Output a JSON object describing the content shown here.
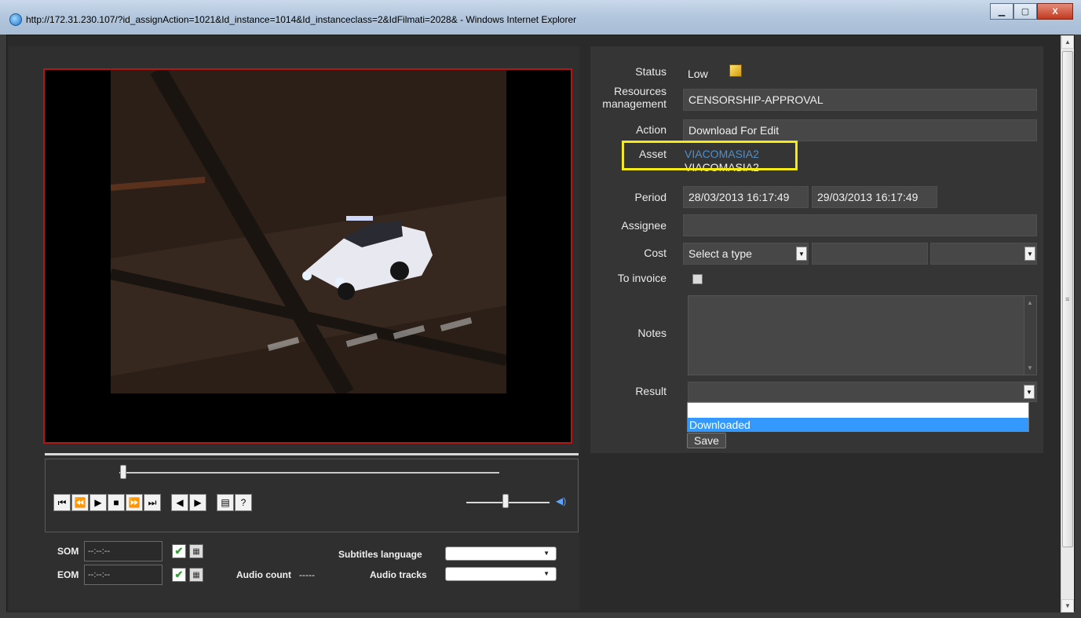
{
  "window": {
    "title": "http://172.31.230.107/?id_assignAction=1021&Id_instance=1014&Id_instanceclass=2&IdFilmati=2028& - Windows Internet Explorer",
    "min_icon": "minimize-icon",
    "max_icon": "maximize-icon",
    "close_label": "X"
  },
  "player": {
    "buttons": [
      "⏮",
      "⏪",
      "▶",
      "■",
      "⏩",
      "⏭"
    ],
    "frame_buttons": [
      "◀",
      "▶"
    ],
    "extra_buttons": [
      "▤",
      "?"
    ],
    "seek_fraction": 0.02,
    "volume_fraction": 0.5
  },
  "timecode": {
    "som_label": "SOM",
    "som_value": "--:--:--",
    "eom_label": "EOM",
    "eom_value": "--:--:--",
    "audio_count_label": "Audio count",
    "audio_count_value": "-----",
    "subtitles_label": "Subtitles language",
    "audio_tracks_label": "Audio tracks"
  },
  "form": {
    "status_label": "Status",
    "status_value": "Low",
    "resources_label_1": "Resources",
    "resources_label_2": "management",
    "resources_value": "CENSORSHIP-APPROVAL",
    "action_label": "Action",
    "action_value": "Download For Edit",
    "asset_label": "Asset",
    "asset_link": "VIACOMASIA2",
    "asset_sub": "VIACOMASIA2",
    "period_label": "Period",
    "period_start": "28/03/2013 16:17:49",
    "period_end": "29/03/2013 16:17:49",
    "assignee_label": "Assignee",
    "cost_label": "Cost",
    "cost_type": "Select a type",
    "to_invoice_label": "To invoice",
    "notes_label": "Notes",
    "result_label": "Result",
    "result_options": [
      "",
      "Downloaded"
    ],
    "save_label": "Save"
  },
  "colors": {
    "highlight": "#f3ea17",
    "video_border": "#b01818",
    "selected_option": "#3399ff",
    "link": "#4d8fcf"
  }
}
